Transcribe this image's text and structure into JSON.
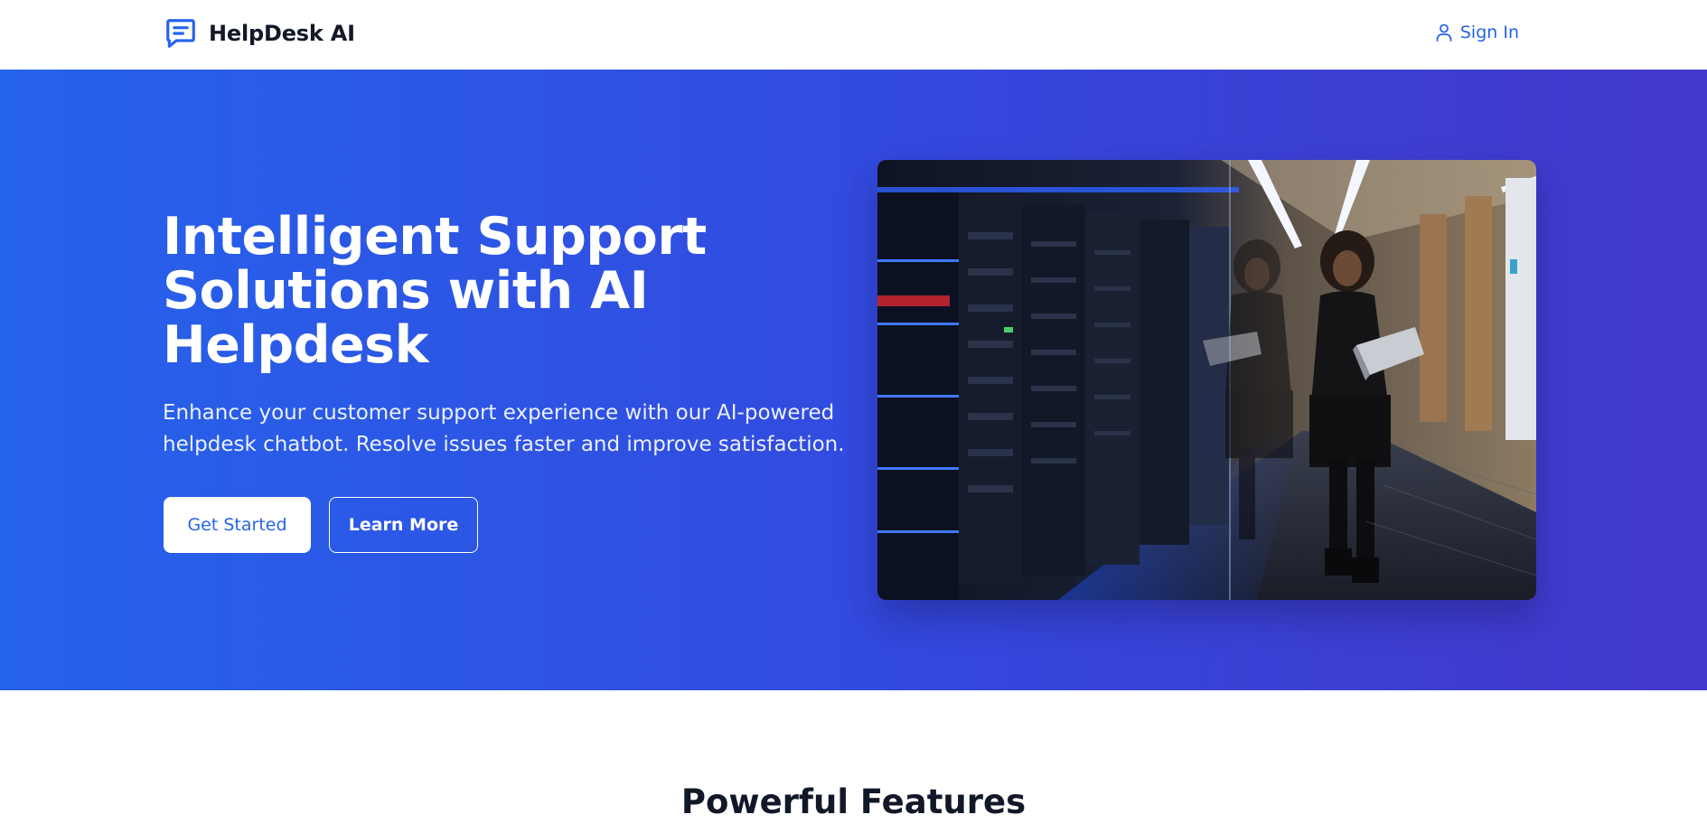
{
  "brand": {
    "name": "HelpDesk AI",
    "icon": "chat-bubble-icon"
  },
  "nav": {
    "signin_label": "Sign In",
    "signin_icon": "user-icon"
  },
  "hero": {
    "title": "Intelligent Support Solutions with AI Helpdesk",
    "subtitle": "Enhance your customer support experience with our AI-powered helpdesk chatbot. Resolve issues faster and improve satisfaction.",
    "primary_button": "Get Started",
    "secondary_button": "Learn More"
  },
  "features": {
    "title": "Powerful Features"
  },
  "colors": {
    "accent": "#2563eb",
    "hero_gradient_start": "#2563eb",
    "hero_gradient_end": "#4338ca",
    "heading": "#111827"
  }
}
